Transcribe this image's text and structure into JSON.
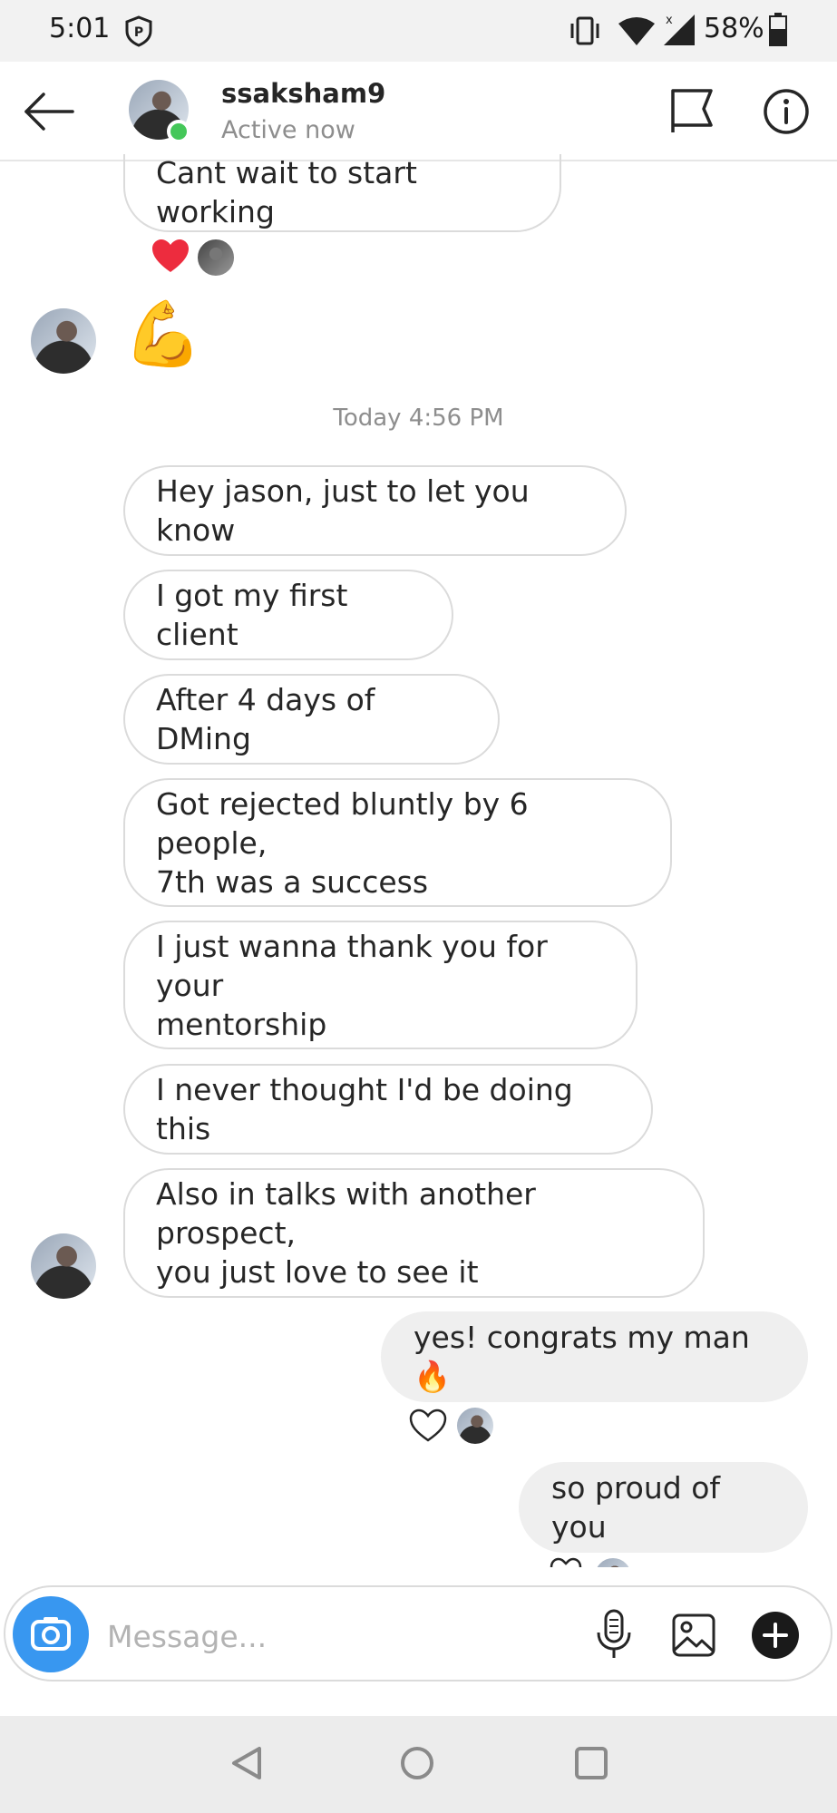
{
  "status_bar": {
    "time": "5:01",
    "battery": "58%"
  },
  "header": {
    "contact_name": "ssaksham9",
    "contact_status": "Active now"
  },
  "conversation": {
    "earlier_message": "Cant wait to start working",
    "flexed_emoji": "💪",
    "timestamp": "Today 4:56 PM",
    "incoming": [
      "Hey jason, just to let you know",
      "I got my first client",
      "After 4 days of DMing",
      "Got rejected bluntly by 6 people,\n7th was a success",
      "I just wanna thank you for your\nmentorship",
      "I never thought I'd be doing this",
      "Also in talks with another prospect,\nyou just love to see it"
    ],
    "outgoing": [
      "yes! congrats my man 🔥",
      "so proud of you"
    ]
  },
  "composer": {
    "placeholder": "Message..."
  },
  "colors": {
    "accent": "#3897f0",
    "online_dot": "#44c759",
    "heart_red": "#ed2c3e",
    "outgoing_bubble": "#efefef"
  },
  "icons": {
    "back": "arrow-left-icon",
    "flag": "flag-icon",
    "info": "info-icon",
    "camera": "camera-icon",
    "mic": "microphone-icon",
    "gallery": "image-icon",
    "plus": "plus-icon"
  }
}
